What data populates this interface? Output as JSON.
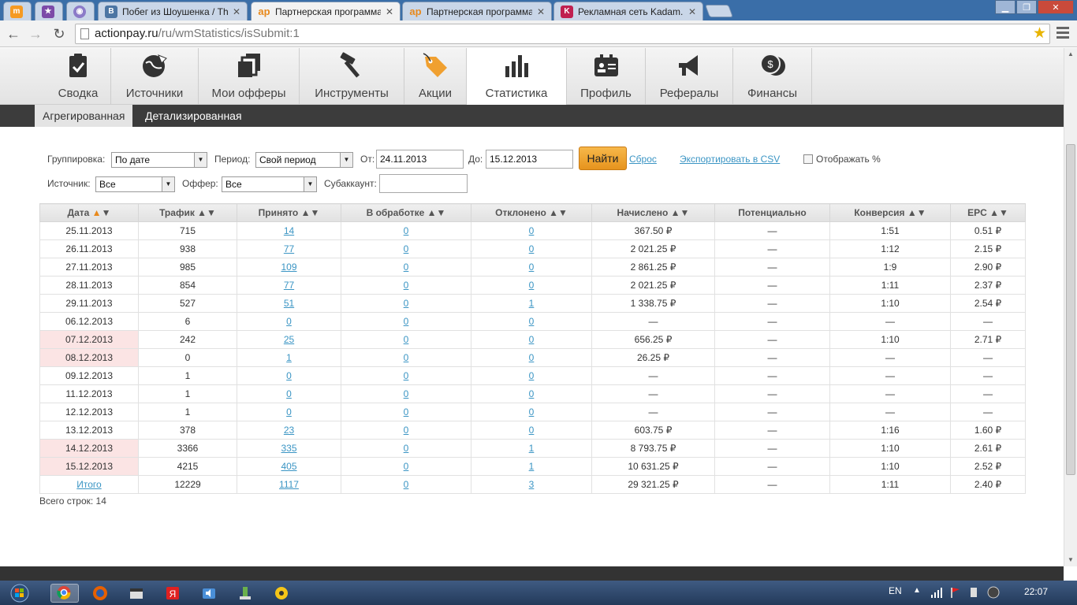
{
  "browser": {
    "tabs": [
      {
        "title": "",
        "favicon": "orange-site-icon"
      },
      {
        "title": "",
        "favicon": "star-site-icon"
      },
      {
        "title": "",
        "favicon": "eye-site-icon"
      },
      {
        "title": "Побег из Шоушенка / Th",
        "favicon": "vk-icon"
      },
      {
        "title": "Партнерская программа",
        "favicon": "actionpay-icon",
        "active": true
      },
      {
        "title": "Партнерская программа",
        "favicon": "actionpay-icon"
      },
      {
        "title": "Рекламная сеть Kadam.ru",
        "favicon": "kadam-icon"
      }
    ],
    "url_host": "actionpay.ru",
    "url_path": "/ru/wmStatistics/isSubmit:1"
  },
  "nav": {
    "items": [
      {
        "label": "Сводка",
        "icon": "clipboard-check-icon"
      },
      {
        "label": "Источники",
        "icon": "globe-arrow-icon"
      },
      {
        "label": "Мои офферы",
        "icon": "stacked-pages-icon"
      },
      {
        "label": "Инструменты",
        "icon": "hammer-icon"
      },
      {
        "label": "Акции",
        "icon": "price-tag-icon"
      },
      {
        "label": "Статистика",
        "icon": "bar-chart-icon",
        "active": true
      },
      {
        "label": "Профиль",
        "icon": "id-card-icon"
      },
      {
        "label": "Рефералы",
        "icon": "megaphone-icon"
      },
      {
        "label": "Финансы",
        "icon": "coins-icon"
      }
    ]
  },
  "subtabs": {
    "aggregated": "Агрегированная",
    "detailed": "Детализированная"
  },
  "filters": {
    "grouping_label": "Группировка:",
    "grouping_value": "По дате",
    "period_label": "Период:",
    "period_value": "Свой период",
    "from_label": "От:",
    "from_value": "24.11.2013",
    "to_label": "До:",
    "to_value": "15.12.2013",
    "find_button": "Найти",
    "reset_link": "Сброс",
    "export_link": "Экспортировать в CSV",
    "show_percent_label": "Отображать %",
    "source_label": "Источник:",
    "source_value": "Все",
    "offer_label": "Оффер:",
    "offer_value": "Все",
    "subaccount_label": "Субаккаунт:",
    "subaccount_value": ""
  },
  "table": {
    "headers": [
      "Дата",
      "Трафик",
      "Принято",
      "В обработке",
      "Отклонено",
      "Начислено",
      "Потенциально",
      "Конверсия",
      "EPC"
    ],
    "sort_arrows": "▲▼",
    "rows": [
      [
        "25.11.2013",
        "715",
        "14",
        "0",
        "0",
        "367.50 ₽",
        "—",
        "1:51",
        "0.51 ₽"
      ],
      [
        "26.11.2013",
        "938",
        "77",
        "0",
        "0",
        "2 021.25 ₽",
        "—",
        "1:12",
        "2.15 ₽"
      ],
      [
        "27.11.2013",
        "985",
        "109",
        "0",
        "0",
        "2 861.25 ₽",
        "—",
        "1:9",
        "2.90 ₽"
      ],
      [
        "28.11.2013",
        "854",
        "77",
        "0",
        "0",
        "2 021.25 ₽",
        "—",
        "1:11",
        "2.37 ₽"
      ],
      [
        "29.11.2013",
        "527",
        "51",
        "0",
        "1",
        "1 338.75 ₽",
        "—",
        "1:10",
        "2.54 ₽"
      ],
      [
        "06.12.2013",
        "6",
        "0",
        "0",
        "0",
        "—",
        "—",
        "—",
        "—"
      ],
      [
        "07.12.2013",
        "242",
        "25",
        "0",
        "0",
        "656.25 ₽",
        "—",
        "1:10",
        "2.71 ₽"
      ],
      [
        "08.12.2013",
        "0",
        "1",
        "0",
        "0",
        "26.25 ₽",
        "—",
        "—",
        "—"
      ],
      [
        "09.12.2013",
        "1",
        "0",
        "0",
        "0",
        "—",
        "—",
        "—",
        "—"
      ],
      [
        "11.12.2013",
        "1",
        "0",
        "0",
        "0",
        "—",
        "—",
        "—",
        "—"
      ],
      [
        "12.12.2013",
        "1",
        "0",
        "0",
        "0",
        "—",
        "—",
        "—",
        "—"
      ],
      [
        "13.12.2013",
        "378",
        "23",
        "0",
        "0",
        "603.75 ₽",
        "—",
        "1:16",
        "1.60 ₽"
      ],
      [
        "14.12.2013",
        "3366",
        "335",
        "0",
        "1",
        "8 793.75 ₽",
        "—",
        "1:10",
        "2.61 ₽"
      ],
      [
        "15.12.2013",
        "4215",
        "405",
        "0",
        "1",
        "10 631.25 ₽",
        "—",
        "1:10",
        "2.52 ₽"
      ]
    ],
    "highlighted_dates": [
      "07.12.2013",
      "08.12.2013",
      "14.12.2013",
      "15.12.2013"
    ],
    "total": [
      "Итого",
      "12229",
      "1117",
      "0",
      "3",
      "29 321.25 ₽",
      "—",
      "1:11",
      "2.40 ₽"
    ],
    "row_count_text": "Всего строк: 14"
  },
  "tray": {
    "lang": "EN",
    "time": "22:07"
  },
  "colors": {
    "accent": "#f0a030",
    "link": "#3b95c4",
    "highlight": "#fbe4e4",
    "dark_bar": "#3c3c3c"
  }
}
